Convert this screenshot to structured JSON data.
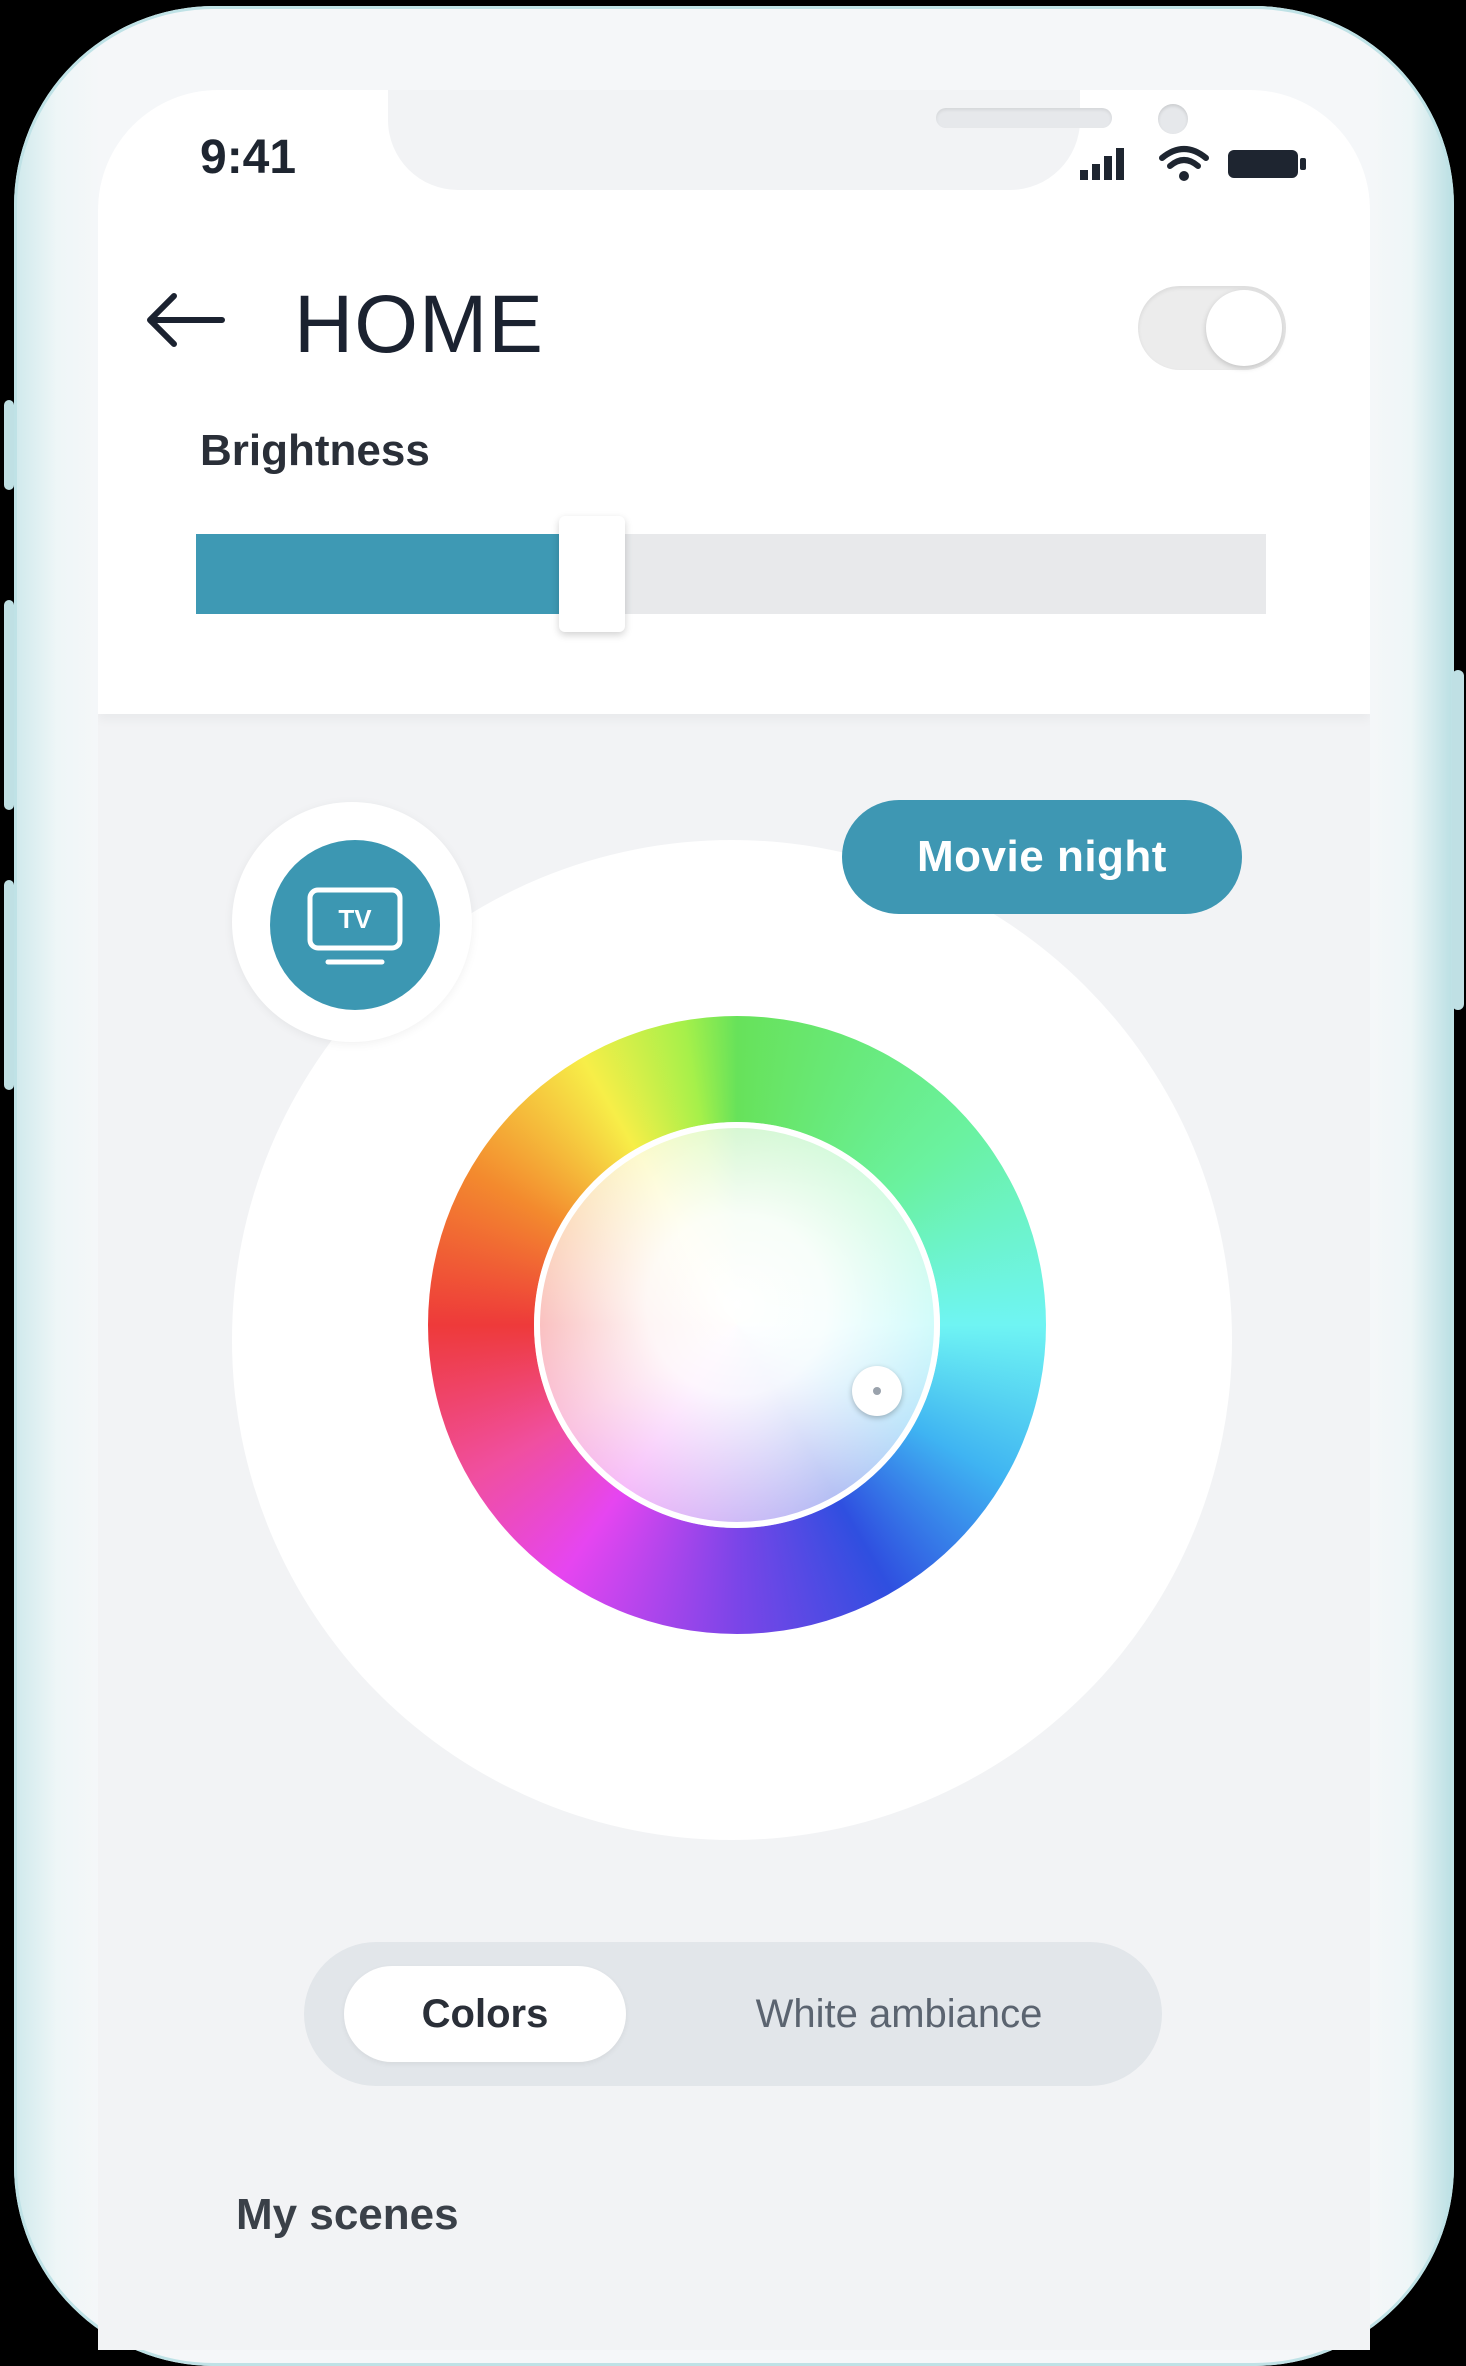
{
  "status_bar": {
    "time": "9:41",
    "icons": [
      "signal-icon",
      "wifi-icon",
      "battery-icon"
    ]
  },
  "header": {
    "back_icon": "arrow-left-icon",
    "title": "HOME",
    "power_toggle_on": true
  },
  "brightness": {
    "label": "Brightness",
    "value_fraction": 0.37
  },
  "color_picker": {
    "room_icon": "tv-icon",
    "room_icon_text": "TV",
    "scene_button_label": "Movie night"
  },
  "mode_tabs": {
    "active": "Colors",
    "inactive": "White ambiance"
  },
  "scenes": {
    "section_title": "My scenes"
  },
  "colors": {
    "accent": "#3e99b4",
    "title_text": "#1b2230",
    "screen_bg": "#f2f3f5"
  }
}
